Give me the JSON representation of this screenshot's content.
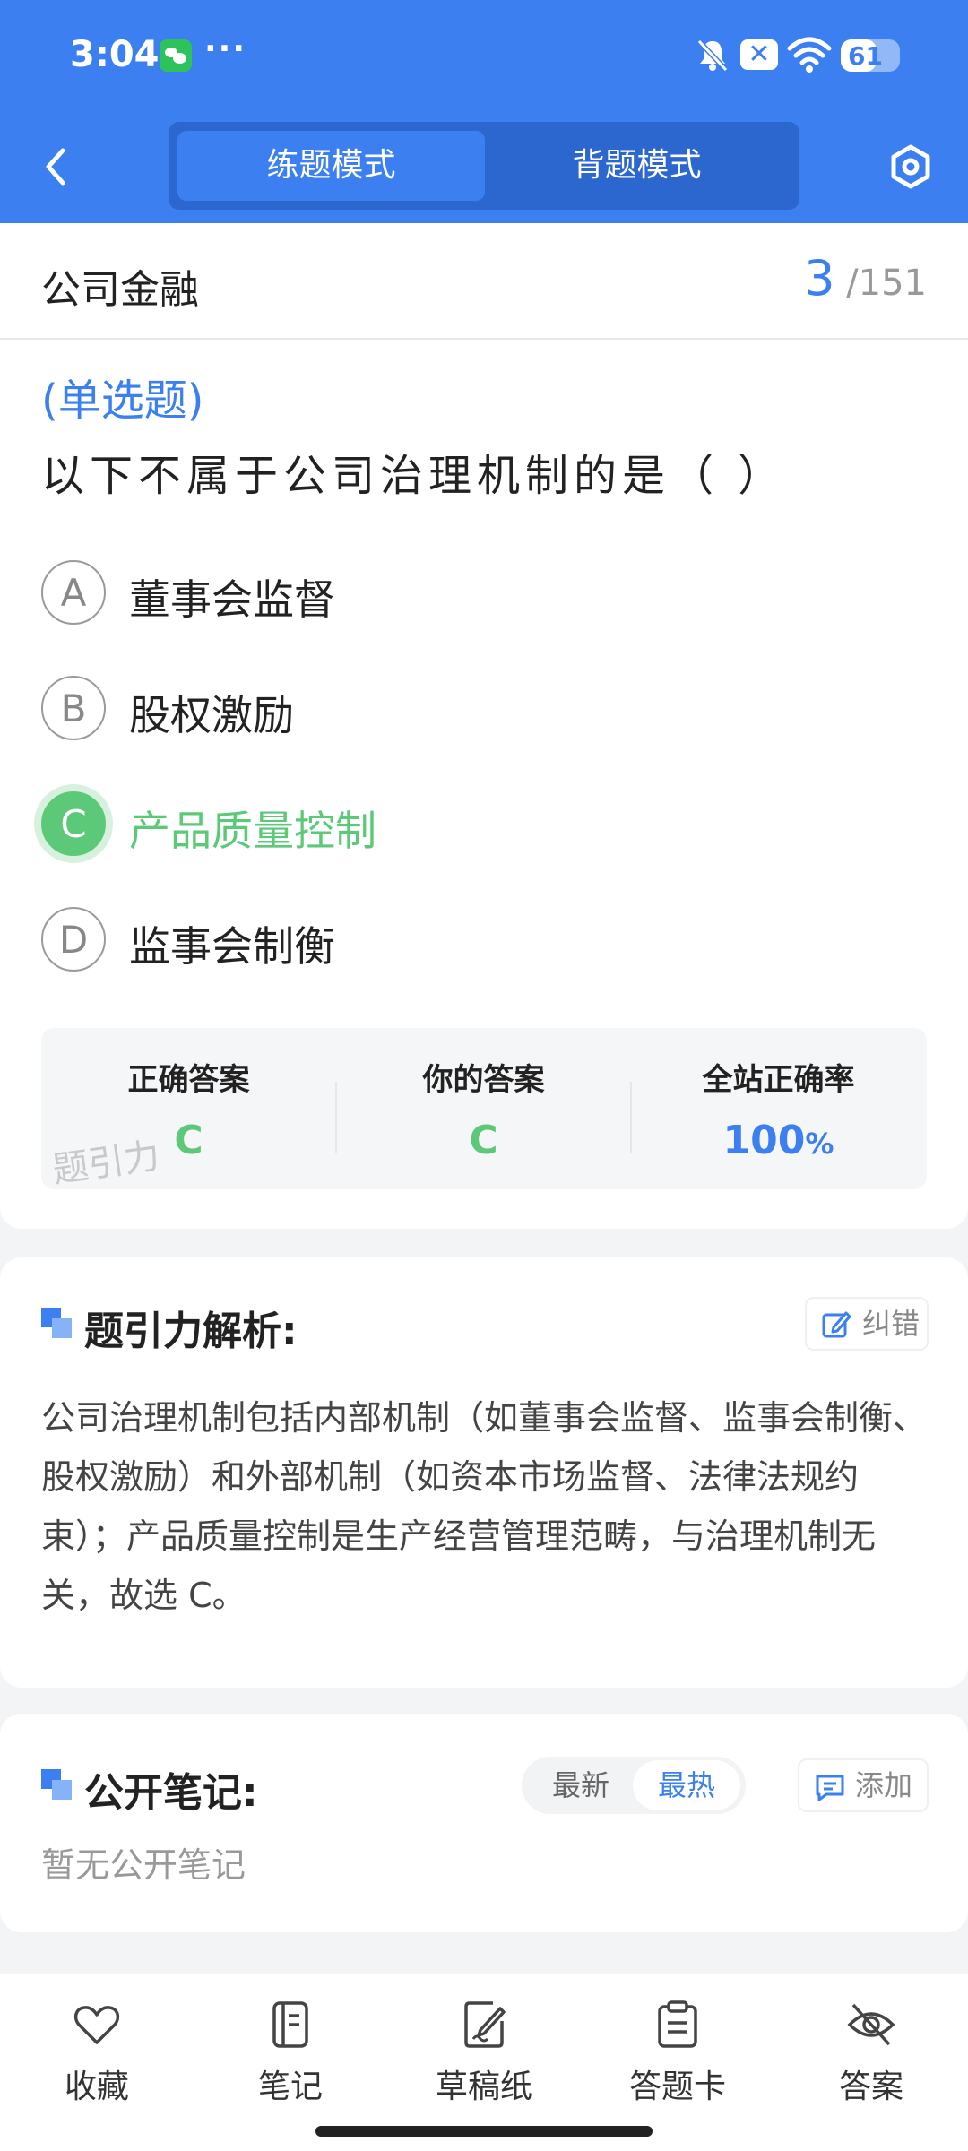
{
  "status_bar": {
    "time": "3:04",
    "dots": "···",
    "battery": "61",
    "battery_percent": 61
  },
  "header": {
    "tabs": [
      {
        "label": "练题模式",
        "active": true
      },
      {
        "label": "背题模式",
        "active": false
      }
    ],
    "back_icon": "chevron-left-icon",
    "settings_icon": "hexagon-settings-icon"
  },
  "subject": {
    "name": "公司金融",
    "current": "3",
    "separator": "/",
    "total": "151"
  },
  "question": {
    "type": "(单选题)",
    "text": "以下不属于公司治理机制的是（    ）",
    "options": [
      {
        "letter": "A",
        "text": "董事会监督",
        "state": "normal"
      },
      {
        "letter": "B",
        "text": "股权激励",
        "state": "normal"
      },
      {
        "letter": "C",
        "text": "产品质量控制",
        "state": "correct"
      },
      {
        "letter": "D",
        "text": "监事会制衡",
        "state": "normal"
      }
    ]
  },
  "answer_summary": {
    "correct_label": "正确答案",
    "correct_value": "C",
    "yours_label": "你的答案",
    "yours_value": "C",
    "rate_label": "全站正确率",
    "rate_value": "100",
    "rate_unit": "%",
    "watermark": "题引力"
  },
  "analysis": {
    "title": "题引力解析:",
    "report_label": "纠错",
    "text": "公司治理机制包括内部机制（如董事会监督、监事会制衡、股权激励）和外部机制（如资本市场监督、法律法规约束）；产品质量控制是生产经营管理范畴，与治理机制无关，故选 C。"
  },
  "notes": {
    "title": "公开笔记:",
    "sort": [
      {
        "label": "最新",
        "active": false
      },
      {
        "label": "最热",
        "active": true
      }
    ],
    "add_label": "添加",
    "empty_text": "暂无公开笔记"
  },
  "bottom_nav": [
    {
      "label": "收藏",
      "icon": "heart-icon"
    },
    {
      "label": "笔记",
      "icon": "notebook-icon"
    },
    {
      "label": "草稿纸",
      "icon": "scratch-paper-icon"
    },
    {
      "label": "答题卡",
      "icon": "answer-sheet-icon"
    },
    {
      "label": "答案",
      "icon": "eye-off-icon"
    }
  ],
  "colors": {
    "primary": "#3b7ff0",
    "correct": "#5cc979",
    "header_dark": "#2c66cf"
  }
}
